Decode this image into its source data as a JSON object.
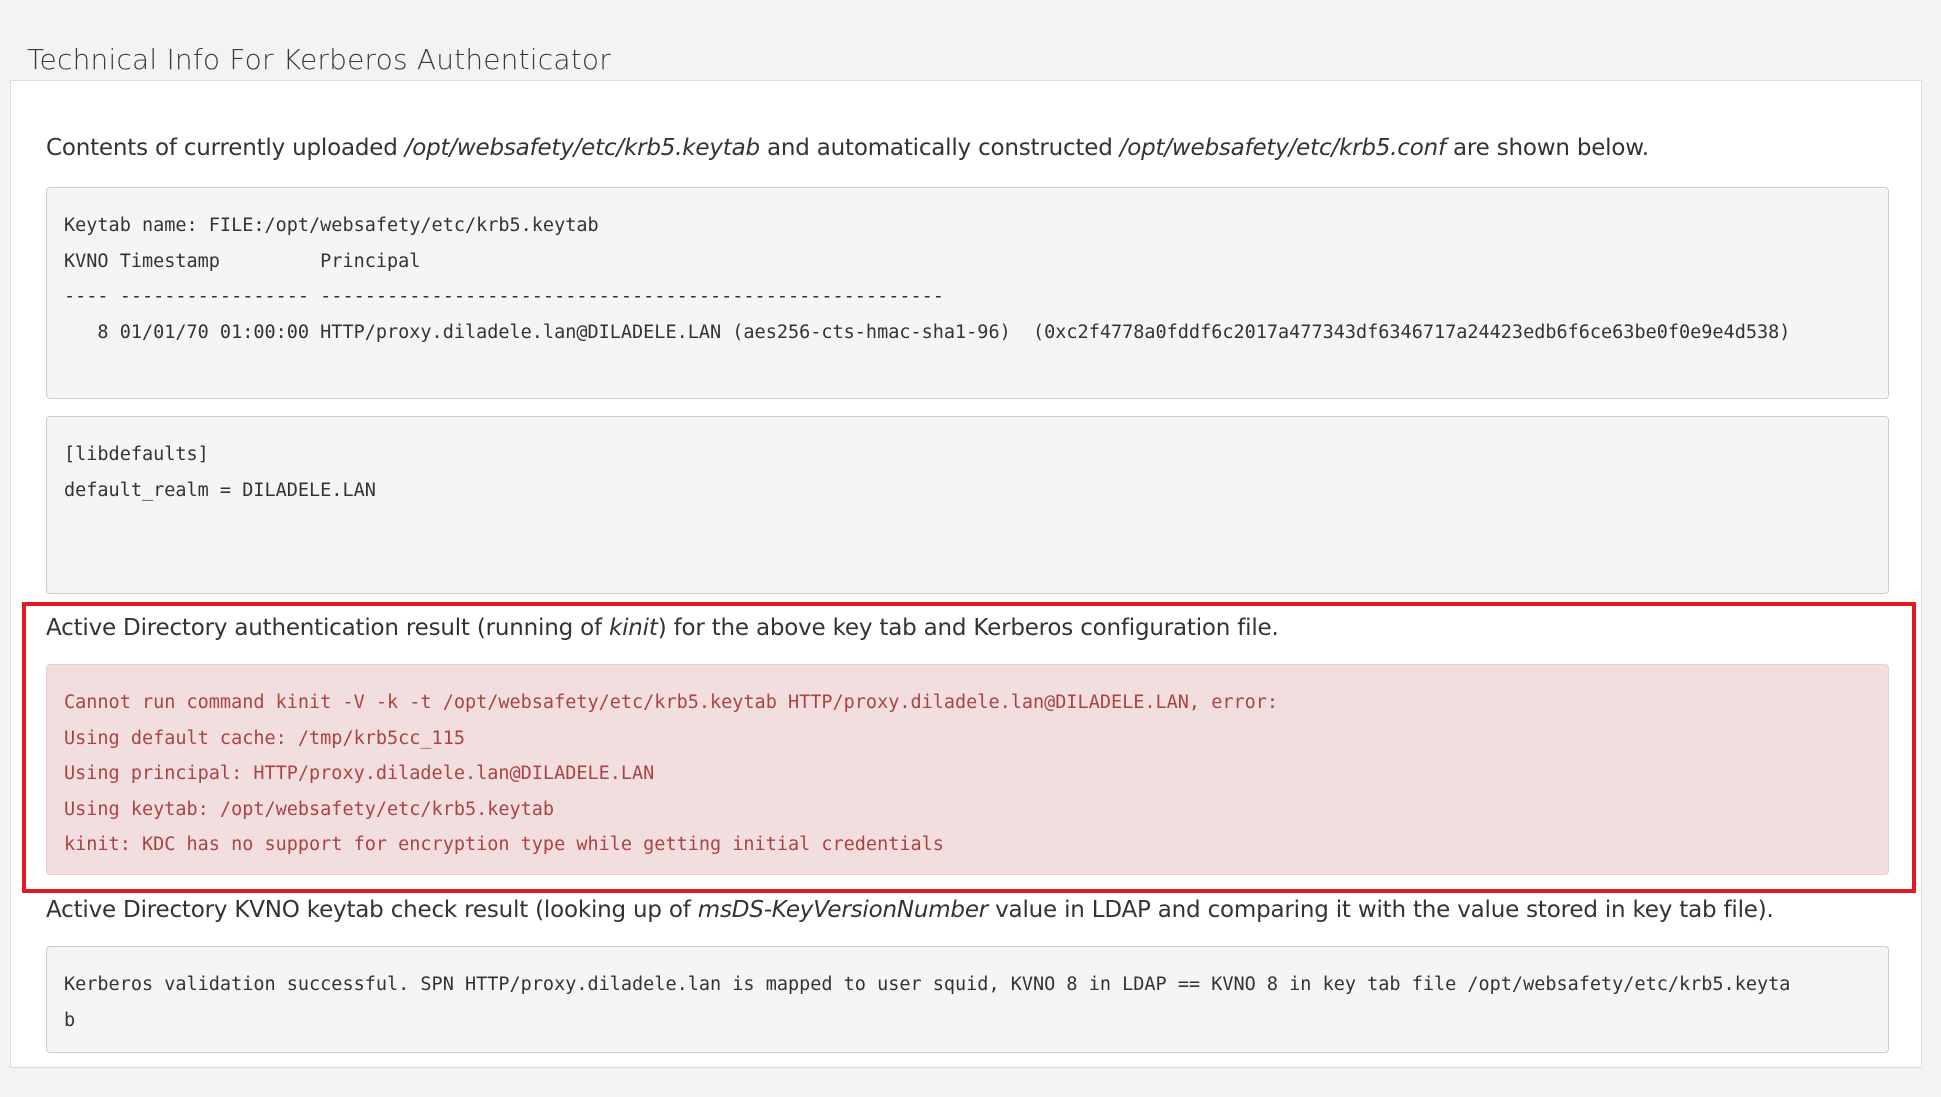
{
  "page": {
    "title": "Technical Info For Kerberos Authenticator"
  },
  "intro": {
    "prefix": "Contents of currently uploaded ",
    "keytab_path": "/opt/websafety/etc/krb5.keytab",
    "middle": " and automatically constructed ",
    "conf_path": "/opt/websafety/etc/krb5.conf",
    "suffix": " are shown below."
  },
  "keytab_output": {
    "lines": [
      "Keytab name: FILE:/opt/websafety/etc/krb5.keytab",
      "KVNO Timestamp         Principal",
      "---- ----------------- --------------------------------------------------------",
      "   8 01/01/70 01:00:00 HTTP/proxy.diladele.lan@DILADELE.LAN (aes256-cts-hmac-sha1-96)  (0xc2f4778a0fddf6c2017a477343df6346717a24423edb6f6ce63be0f0e9e4d538)"
    ]
  },
  "krb5_conf": {
    "lines": [
      "[libdefaults]",
      "default_realm = DILADELE.LAN"
    ]
  },
  "ad_auth": {
    "prefix": "Active Directory authentication result (running of ",
    "command": "kinit",
    "suffix": ") for the above key tab and Kerberos configuration file.",
    "error_lines": [
      "Cannot run command kinit -V -k -t /opt/websafety/etc/krb5.keytab HTTP/proxy.diladele.lan@DILADELE.LAN, error:",
      "Using default cache: /tmp/krb5cc_115",
      "Using principal: HTTP/proxy.diladele.lan@DILADELE.LAN",
      "Using keytab: /opt/websafety/etc/krb5.keytab",
      "kinit: KDC has no support for encryption type while getting initial credentials"
    ],
    "error_text_color": "#a94442",
    "error_bg_color": "#f2dede",
    "highlight_color": "#e01b24"
  },
  "kvno_check": {
    "prefix": "Active Directory KVNO keytab check result (looking up of ",
    "attribute": "msDS-KeyVersionNumber",
    "suffix": " value in LDAP and comparing it with the value stored in key tab file).",
    "lines": [
      "Kerberos validation successful. SPN HTTP/proxy.diladele.lan is mapped to user squid, KVNO 8 in LDAP == KVNO 8 in key tab file /opt/websafety/etc/krb5.keyta",
      "b"
    ]
  }
}
